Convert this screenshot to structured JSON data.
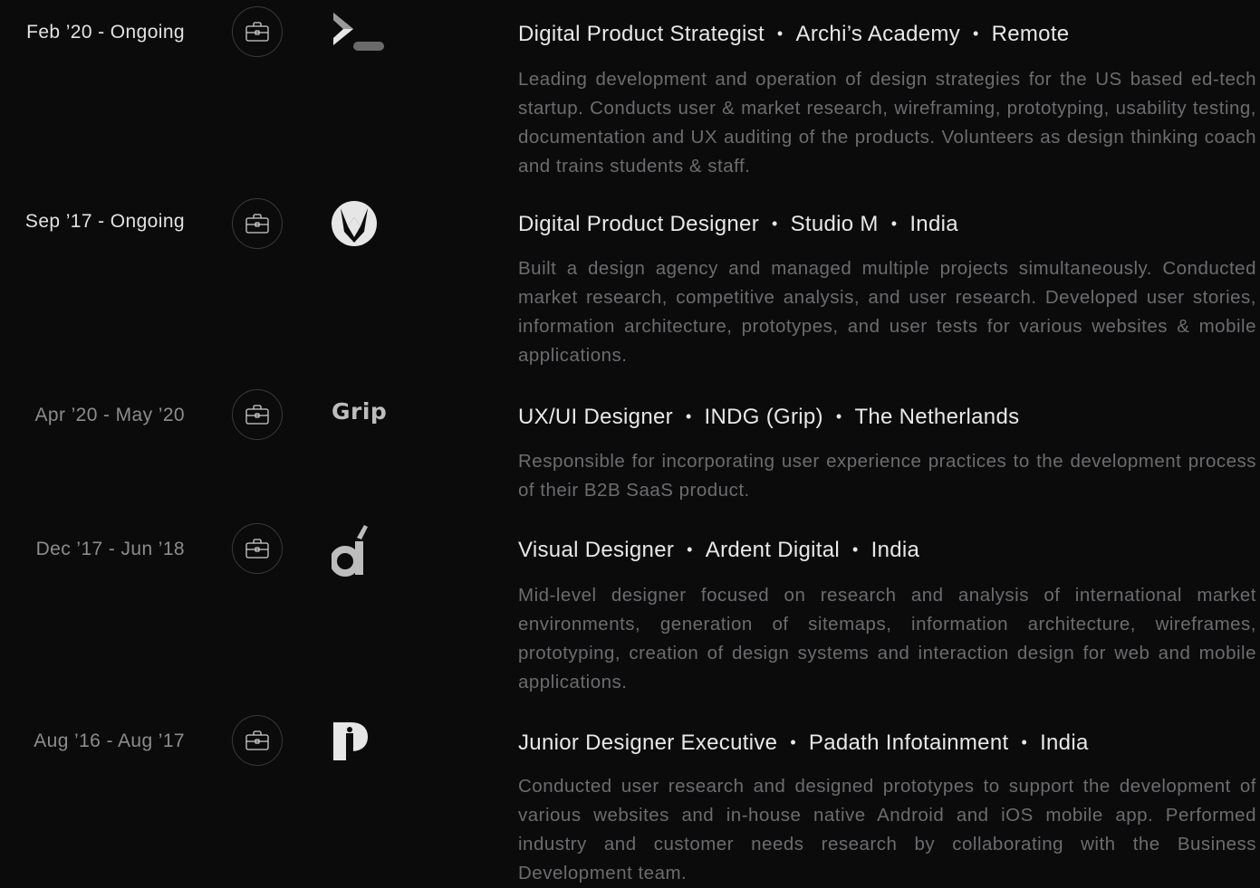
{
  "colors": {
    "background": "#0b0b0c",
    "text_primary": "#e8e8e8",
    "text_secondary": "#6c6c6e",
    "date_past": "#8c8c8c",
    "circle_border": "#3a3a3c"
  },
  "experiences": [
    {
      "date": "Feb ’20 - Ongoing",
      "icon": "briefcase-icon",
      "logo": "archis-academy-logo",
      "role": "Digital Product Strategist",
      "company": "Archi’s Academy",
      "location": "Remote",
      "description": "Leading development and operation of design strategies for the US based ed-tech startup. Conducts user & market research, wireframing, prototyping, usability testing, documentation and UX auditing of the products. Volunteers as design thinking coach and trains students & staff."
    },
    {
      "date": "Sep ’17 - Ongoing",
      "icon": "briefcase-icon",
      "logo": "studio-m-logo",
      "role": "Digital Product Designer",
      "company": "Studio M",
      "location": "India",
      "description": "Built a design agency and managed multiple projects simultaneously. Conducted market research, competitive analysis, and user research. Developed user stories, information architecture, prototypes, and user tests for various websites & mobile applications."
    },
    {
      "date": "Apr ’20 - May ’20",
      "icon": "briefcase-icon",
      "logo": "grip-logo",
      "logo_text": "Grip",
      "role": "UX/UI Designer",
      "company": "INDG (Grip)",
      "location": "The Netherlands",
      "description": "Responsible for incorporating user experience practices to the development process of their B2B SaaS product."
    },
    {
      "date": "Dec ’17 - Jun ’18",
      "icon": "briefcase-icon",
      "logo": "ardent-digital-logo",
      "role": "Visual Designer",
      "company": "Ardent Digital",
      "location": "India",
      "description": "Mid-level designer focused on research and analysis of international market environments, generation of sitemaps, information architecture, wireframes, prototyping, creation of design systems and interaction design for web and mobile applications."
    },
    {
      "date": "Aug ’16 - Aug ’17",
      "icon": "briefcase-icon",
      "logo": "padath-logo",
      "role": "Junior Designer Executive",
      "company": "Padath Infotainment",
      "location": "India",
      "description": "Conducted user research and designed prototypes to support the development of various websites and in-house native Android and iOS mobile app. Performed industry and customer needs research by collaborating with the Business Development team."
    }
  ]
}
